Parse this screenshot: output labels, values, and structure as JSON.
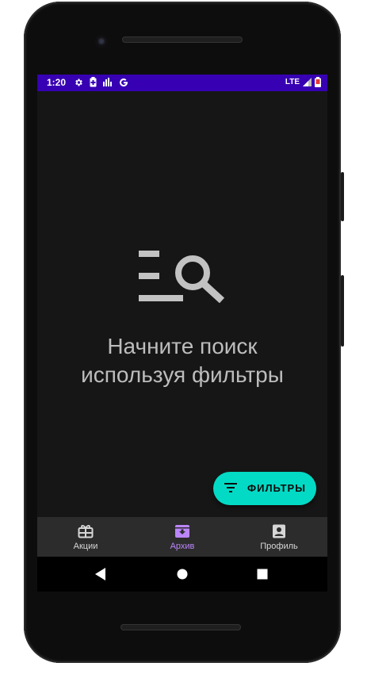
{
  "status_bar": {
    "time": "1:20",
    "network": "LTE"
  },
  "main": {
    "empty_icon": "filter-search-icon",
    "empty_line1": "Начните поиск",
    "empty_line2": "используя фильтры"
  },
  "fab": {
    "label": "ФИЛЬТРЫ",
    "icon": "filter-list-icon"
  },
  "bottom_nav": {
    "items": [
      {
        "label": "Акции",
        "icon": "gift-card-icon",
        "active": false
      },
      {
        "label": "Архив",
        "icon": "archive-icon",
        "active": true
      },
      {
        "label": "Профиль",
        "icon": "account-box-icon",
        "active": false
      }
    ]
  },
  "colors": {
    "status_bar": "#3700b3",
    "background": "#161616",
    "fab": "#03dac5",
    "active_nav": "#bb86fc",
    "bottom_nav": "#2c2c2c"
  }
}
